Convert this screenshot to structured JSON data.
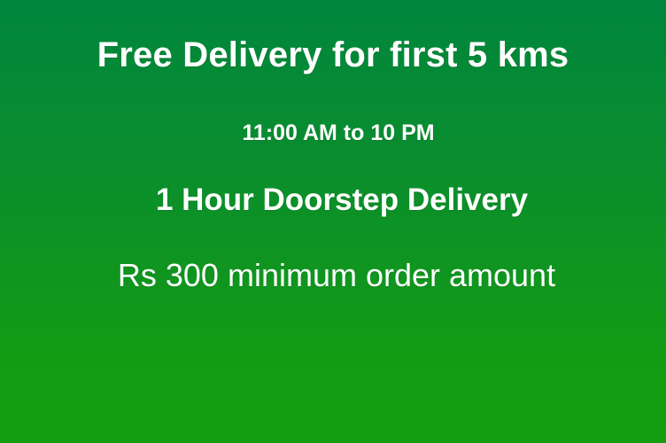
{
  "banner": {
    "headline": "Free Delivery for first 5 kms",
    "hours": "11:00 AM to 10 PM",
    "delivery_speed": "1 Hour Doorstep Delivery",
    "minimum_order": "Rs 300 minimum order amount",
    "colors": {
      "background_top": "#00863d",
      "background_bottom": "#159e0f",
      "text": "#ffffff"
    }
  }
}
